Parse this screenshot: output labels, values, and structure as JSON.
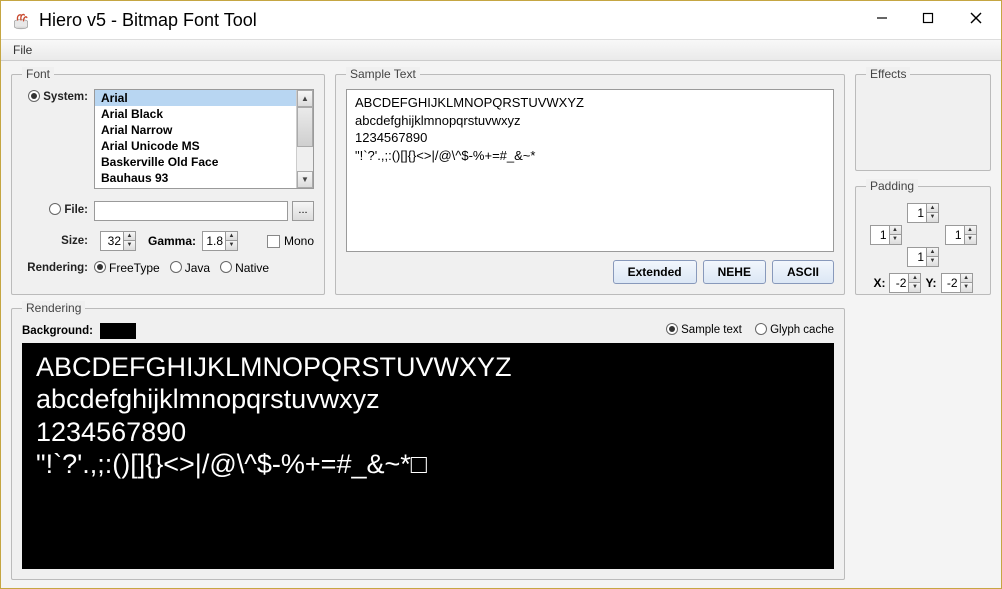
{
  "window": {
    "title": "Hiero v5 - Bitmap Font Tool"
  },
  "menubar": {
    "file": "File"
  },
  "font": {
    "legend": "Font",
    "system_label": "System:",
    "file_label": "File:",
    "fonts": [
      "Arial",
      "Arial Black",
      "Arial Narrow",
      "Arial Unicode MS",
      "Baskerville Old Face",
      "Bauhaus 93"
    ],
    "selected_font": "Arial",
    "file_value": "",
    "browse_label": "...",
    "size_label": "Size:",
    "size_value": "32",
    "gamma_label": "Gamma:",
    "gamma_value": "1.8",
    "mono_label": "Mono",
    "rendering_label": "Rendering:",
    "rendering_options": {
      "freetype": "FreeType",
      "java": "Java",
      "native": "Native"
    }
  },
  "sample": {
    "legend": "Sample Text",
    "text": "ABCDEFGHIJKLMNOPQRSTUVWXYZ\nabcdefghijklmnopqrstuvwxyz\n1234567890\n\"!`?'.,;:()[]{}<>|/@\\^$-%+=#_&~*",
    "buttons": {
      "extended": "Extended",
      "nehe": "NEHE",
      "ascii": "ASCII"
    }
  },
  "effects": {
    "legend": "Effects"
  },
  "rendering": {
    "legend": "Rendering",
    "background_label": "Background:",
    "background_color": "#000000",
    "view_options": {
      "sample": "Sample text",
      "glyph": "Glyph cache"
    },
    "preview_text": "ABCDEFGHIJKLMNOPQRSTUVWXYZ\nabcdefghijklmnopqrstuvwxyz\n1234567890\n\"!`?'.,;:()[]{}<>|/@\\^$-%+=#_&~*□"
  },
  "padding": {
    "legend": "Padding",
    "top": "1",
    "left": "1",
    "right": "1",
    "bottom": "1",
    "x_label": "X:",
    "x_value": "-2",
    "y_label": "Y:",
    "y_value": "-2"
  }
}
